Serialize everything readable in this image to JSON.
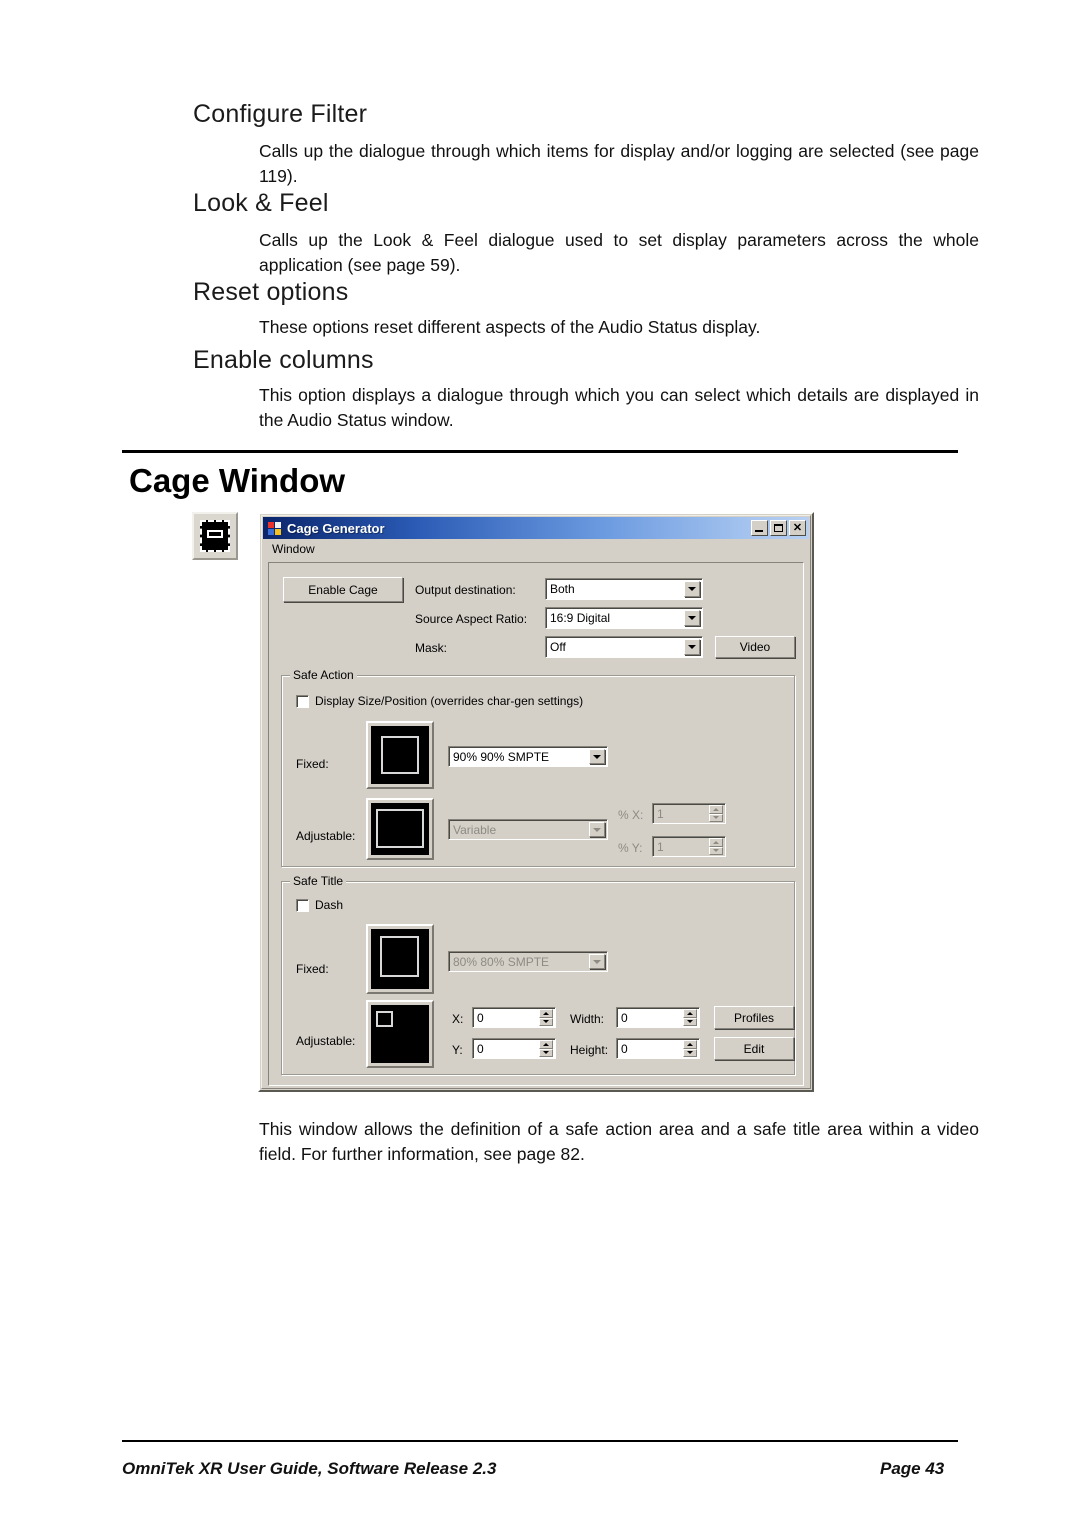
{
  "document": {
    "sections": [
      {
        "heading": "Configure Filter",
        "body": "Calls up the dialogue through which items for display and/or logging are selected (see page 119)."
      },
      {
        "heading": "Look & Feel",
        "body": "Calls up the Look & Feel dialogue used to set display parameters across the whole application (see page 59)."
      },
      {
        "heading": "Reset options",
        "body": "These options reset different aspects of the Audio Status display."
      },
      {
        "heading": "Enable columns",
        "body": "This option displays a dialogue through which you can select which details are displayed in the Audio Status window."
      }
    ],
    "chapter_title": "Cage Window",
    "figure_caption": "This window allows the definition of a safe action area and a safe title area within a video field. For further information, see page 82.",
    "footer": {
      "left": "OmniTek XR User Guide, Software Release 2.3",
      "right": "Page 43"
    }
  },
  "dialog": {
    "title": "Cage Generator",
    "app_icon": "windows-logo-icon",
    "title_buttons": {
      "minimize": "minimize-icon",
      "maximize": "maximize-icon",
      "close": "✕"
    },
    "menu": {
      "window": "Window"
    },
    "toolbar": {
      "enable_cage_label": "Enable Cage",
      "video_button_label": "Video"
    },
    "fields": {
      "output_destination_label": "Output destination:",
      "output_destination_value": "Both",
      "source_aspect_ratio_label": "Source Aspect Ratio:",
      "source_aspect_ratio_value": "16:9 Digital",
      "mask_label": "Mask:",
      "mask_value": "Off"
    },
    "safe_action": {
      "group_label": "Safe Action",
      "display_size_checkbox_label": "Display Size/Position (overrides char-gen settings)",
      "fixed_label": "Fixed:",
      "fixed_value": "90% 90% SMPTE",
      "adjustable_label": "Adjustable:",
      "adjustable_value": "Variable",
      "percent_x_label": "% X:",
      "percent_x_value": "1",
      "percent_y_label": "% Y:",
      "percent_y_value": "1"
    },
    "safe_title": {
      "group_label": "Safe Title",
      "dash_checkbox_label": "Dash",
      "fixed_label": "Fixed:",
      "fixed_value": "80% 80% SMPTE",
      "adjustable_label": "Adjustable:",
      "x_label": "X:",
      "x_value": "0",
      "y_label": "Y:",
      "y_value": "0",
      "width_label": "Width:",
      "width_value": "0",
      "height_label": "Height:",
      "height_value": "0",
      "profiles_button_label": "Profiles",
      "edit_button_label": "Edit"
    }
  },
  "colors": {
    "dialog_face": "#d4d0c8",
    "titlebar_start": "#0a246a",
    "titlebar_end": "#b7d0f2",
    "page_background": "#ffffff"
  }
}
